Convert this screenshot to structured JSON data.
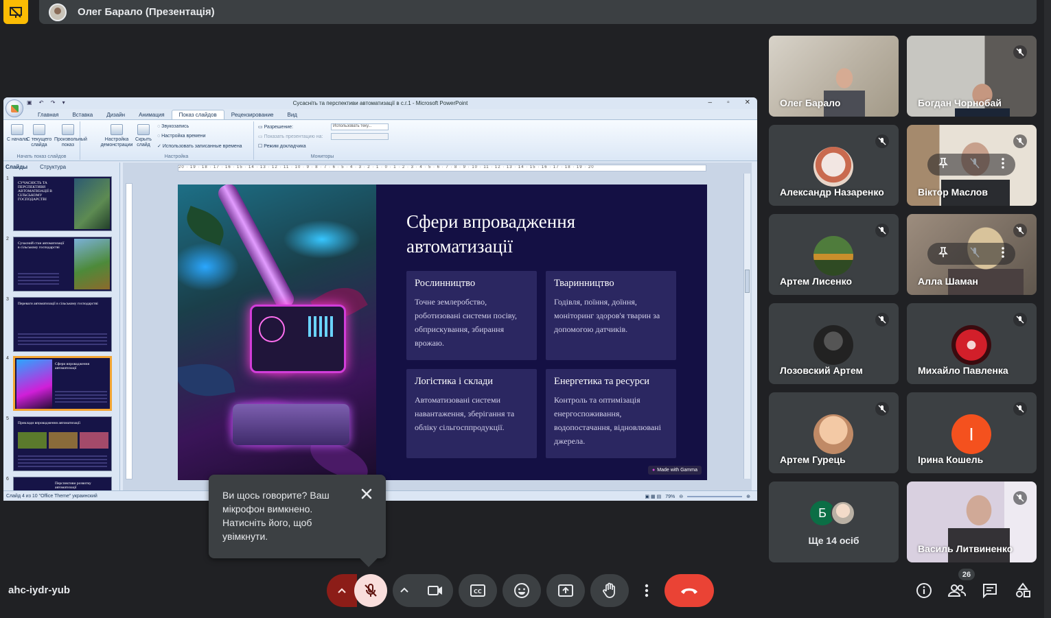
{
  "presenter_bar": {
    "title": "Олег Барало (Презентація)"
  },
  "powerpoint": {
    "window_title": "Сусаснiть та перспективи автоматизацiї в с.г.1 - Microsoft PowerPoint",
    "tabs": [
      "Главная",
      "Вставка",
      "Дизайн",
      "Анимация",
      "Показ слайдов",
      "Рецензирование",
      "Вид"
    ],
    "active_tab": "Показ слайдов",
    "ribbon": {
      "btn_from_start": "С начала",
      "btn_from_current": "С текущего слайда",
      "btn_custom": "Произвольный показ",
      "group_start": "Начать показ слайдов",
      "btn_setup": "Настройка демонстрации",
      "btn_hide": "Скрыть слайд",
      "opt_sound": "Звукозапись",
      "opt_timing": "Настройка времени",
      "opt_use_timing": "Использовать записанные времена",
      "group_setup": "Настройка",
      "opt_resolution": "Разрешение:",
      "resolution_value": "Использовать теку...",
      "opt_show_on": "Показать презентацию на:",
      "opt_presenter": "Режим докладчика",
      "group_monitors": "Мониторы"
    },
    "left_tabs": {
      "slides": "Слайды",
      "outline": "Структура"
    },
    "thumbnails": [
      {
        "num": "1",
        "text": "СУЧАСНIСТЬ ТА ПЕРСПЕКТИВИ АВТОМАТИЗАЦIЇ В СIЛЬСЬКОМУ ГОСПОДАРСТВI"
      },
      {
        "num": "2",
        "text": "Сучасний стан автоматизації в сільському господарстві"
      },
      {
        "num": "3",
        "text": "Переваги автоматизації в сільському господарстві"
      },
      {
        "num": "4",
        "text": "Сфери впровадження автоматизації"
      },
      {
        "num": "5",
        "text": "Приклади впровадження автоматизації"
      },
      {
        "num": "6",
        "text": "Перспективи розвитку автоматизації"
      }
    ],
    "status": "Слайд 4 из 10   \"Office Theme\"   украинский",
    "zoom": "79%",
    "ruler": "20 · 19 · 18 · 17 · 16 · 15 · 14 · 13 · 12 · 11 · 10 · 9 · 8 · 7 · 6 · 5 · 4 · 3 · 2 · 1 · 0 · 1 · 2 · 3 · 4 · 5 · 6 · 7 · 8 · 9 · 10 · 11 · 12 · 13 · 14 · 15 · 16 · 17 · 18 · 19 · 20",
    "slide": {
      "title": "Сфери впровадження автоматизації",
      "cards": [
        {
          "heading": "Рослинництво",
          "body": "Точне землеробство, роботизовані системи посіву, обприскування, збирання врожаю."
        },
        {
          "heading": "Тваринництво",
          "body": "Годівля, поїння, доїння, моніторинг здоров'я тварин за допомогою датчиків."
        },
        {
          "heading": "Логістика і склади",
          "body": "Автоматизовані системи навантаження, зберігання та обліку сільгосппродукції."
        },
        {
          "heading": "Енергетика та ресурси",
          "body": "Контроль та оптимізація енергоспоживання, водопостачання, відновлювані джерела."
        }
      ],
      "badge": "Made with Gamma"
    }
  },
  "tooltip": {
    "text": "Ви щось говорите? Ваш мікрофон вимкнено. Натисніть його, щоб увімкнути."
  },
  "participants": [
    {
      "name": "Олег Барало"
    },
    {
      "name": "Богдан Чорнобай"
    },
    {
      "name": "Александр Назаренко"
    },
    {
      "name": "Віктор Маслов"
    },
    {
      "name": "Артем Лисенко"
    },
    {
      "name": "Алла Шаман"
    },
    {
      "name": "Лозовский Артем"
    },
    {
      "name": "Михайло Павленка"
    },
    {
      "name": "Артем Гурець"
    },
    {
      "name": "Ірина Кошель",
      "initial": "І"
    },
    {
      "name": "Ще 14 осіб",
      "initial": "Б"
    },
    {
      "name": "Василь Литвиненко"
    }
  ],
  "toolbar": {
    "meeting_code": "ahc-iydr-yub",
    "people_count": "26"
  },
  "colors": {
    "end_call": "#ea4335",
    "mic_off_bg": "#f9dedc",
    "present_badge": "#fbbc04"
  }
}
